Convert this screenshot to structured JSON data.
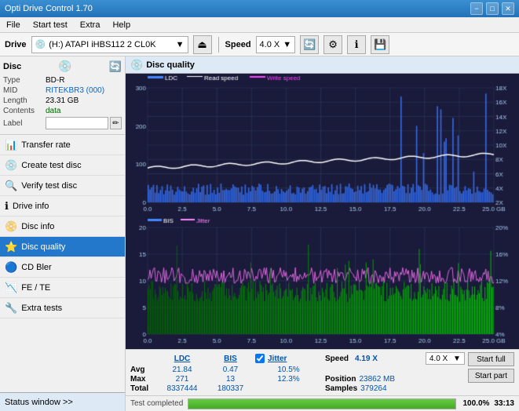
{
  "titlebar": {
    "title": "Opti Drive Control 1.70",
    "min": "−",
    "max": "□",
    "close": "✕"
  },
  "menubar": {
    "items": [
      "File",
      "Start test",
      "Extra",
      "Help"
    ]
  },
  "drive_toolbar": {
    "drive_label": "Drive",
    "drive_value": "(H:) ATAPI iHBS112  2 CL0K",
    "speed_label": "Speed",
    "speed_value": "4.0 X"
  },
  "disc_panel": {
    "title": "Disc",
    "rows": [
      {
        "label": "Type",
        "value": "BD-R",
        "style": "normal"
      },
      {
        "label": "MID",
        "value": "RITEKBR3 (000)",
        "style": "blue"
      },
      {
        "label": "Length",
        "value": "23.31 GB",
        "style": "normal"
      },
      {
        "label": "Contents",
        "value": "data",
        "style": "green"
      },
      {
        "label": "Label",
        "value": "",
        "style": "input"
      }
    ]
  },
  "nav": {
    "items": [
      {
        "id": "transfer-rate",
        "label": "Transfer rate",
        "icon": "📊"
      },
      {
        "id": "create-test-disc",
        "label": "Create test disc",
        "icon": "💿"
      },
      {
        "id": "verify-test-disc",
        "label": "Verify test disc",
        "icon": "🔍"
      },
      {
        "id": "drive-info",
        "label": "Drive info",
        "icon": "ℹ️"
      },
      {
        "id": "disc-info",
        "label": "Disc info",
        "icon": "📀"
      },
      {
        "id": "disc-quality",
        "label": "Disc quality",
        "icon": "⭐",
        "active": true
      },
      {
        "id": "cd-bler",
        "label": "CD Bler",
        "icon": "🔵"
      },
      {
        "id": "fe-te",
        "label": "FE / TE",
        "icon": "📉"
      },
      {
        "id": "extra-tests",
        "label": "Extra tests",
        "icon": "🔧"
      }
    ],
    "status_window": "Status window >>"
  },
  "dq_panel": {
    "title": "Disc quality",
    "legend": [
      {
        "name": "LDC",
        "color": "#4488ff"
      },
      {
        "name": "Read speed",
        "color": "#ffffff"
      },
      {
        "name": "Write speed",
        "color": "#ff44ff"
      }
    ],
    "legend2": [
      {
        "name": "BIS",
        "color": "#4488ff"
      },
      {
        "name": "Jitter",
        "color": "#ff44ff"
      }
    ]
  },
  "stats": {
    "headers": [
      "LDC",
      "BIS",
      "Jitter",
      "Speed",
      ""
    ],
    "avg_label": "Avg",
    "avg_ldc": "21.84",
    "avg_bis": "0.47",
    "avg_jitter": "10.5%",
    "avg_speed": "4.19 X",
    "max_label": "Max",
    "max_ldc": "271",
    "max_bis": "13",
    "max_jitter": "12.3%",
    "total_label": "Total",
    "total_ldc": "8337444",
    "total_bis": "180337",
    "position_label": "Position",
    "position_val": "23862 MB",
    "samples_label": "Samples",
    "samples_val": "379264",
    "speed_dropdown": "4.0 X",
    "btn_full": "Start full",
    "btn_part": "Start part",
    "jitter_label": "Jitter",
    "jitter_checked": true
  },
  "progress": {
    "status": "Test completed",
    "pct": "100.0%",
    "time": "33:13"
  },
  "chart1": {
    "y_left_max": 300,
    "y_right_labels": [
      "18X",
      "16X",
      "14X",
      "12X",
      "10X",
      "8X",
      "6X",
      "4X",
      "2X"
    ],
    "x_labels": [
      "0.0",
      "2.5",
      "5.0",
      "7.5",
      "10.0",
      "12.5",
      "15.0",
      "17.5",
      "20.0",
      "22.5",
      "25.0 GB"
    ]
  },
  "chart2": {
    "y_left_max": 20,
    "y_right_labels": [
      "20%",
      "16%",
      "12%",
      "8%",
      "4%"
    ],
    "x_labels": [
      "0.0",
      "2.5",
      "5.0",
      "7.5",
      "10.0",
      "12.5",
      "15.0",
      "17.5",
      "20.0",
      "22.5",
      "25.0 GB"
    ]
  }
}
